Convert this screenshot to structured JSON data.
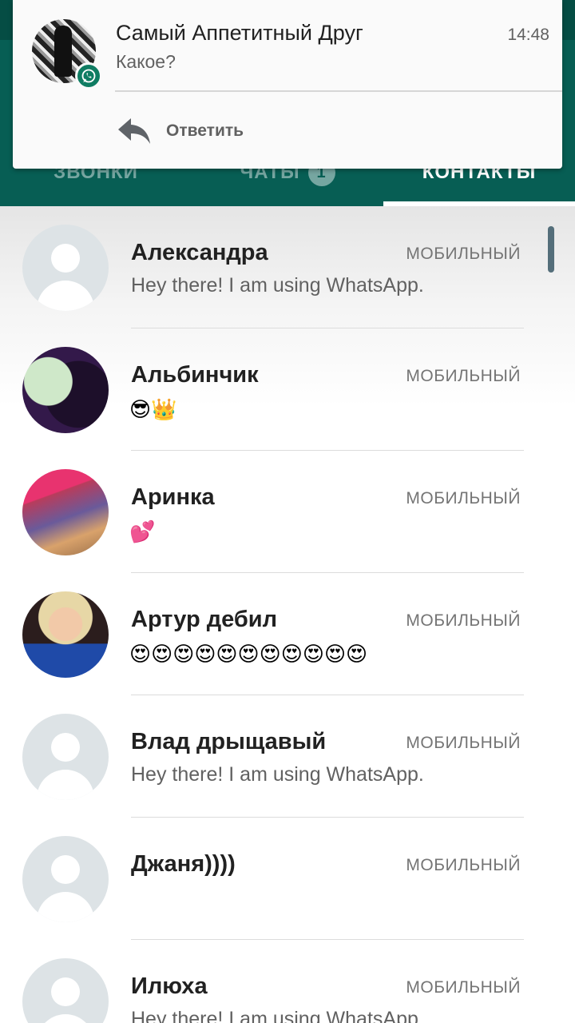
{
  "tabs": [
    {
      "label": "ЗВОНКИ"
    },
    {
      "label": "ЧАТЫ",
      "badge": "1"
    },
    {
      "label": "КОНТАКТЫ"
    }
  ],
  "notification": {
    "title": "Самый Аппетитный Друг",
    "time": "14:48",
    "text": "Какое?",
    "reply_label": "Ответить",
    "app_icon": "whatsapp-icon"
  },
  "contacts": [
    {
      "name": "Александра",
      "type": "МОБИЛЬНЫЙ",
      "status": "Hey there! I am using WhatsApp.",
      "avatar": "default"
    },
    {
      "name": "Альбинчик",
      "type": "МОБИЛЬНЫЙ",
      "status": "😎👑",
      "avatar": "photo"
    },
    {
      "name": "Аринка",
      "type": "МОБИЛЬНЫЙ",
      "status": "💕",
      "avatar": "photo"
    },
    {
      "name": "Артур дебил",
      "type": "МОБИЛЬНЫЙ",
      "status": "😍😍😍😍😍😍😍😍😍😍😍",
      "avatar": "photo"
    },
    {
      "name": "Влад дрыщавый",
      "type": "МОБИЛЬНЫЙ",
      "status": "Hey there! I am using WhatsApp.",
      "avatar": "default"
    },
    {
      "name": "Джаня))))",
      "type": "МОБИЛЬНЫЙ",
      "status": "",
      "avatar": "default"
    },
    {
      "name": "Илюха",
      "type": "МОБИЛЬНЫЙ",
      "status": "Hey there! I am using WhatsApp.",
      "avatar": "default"
    }
  ],
  "colors": {
    "header": "#075e54",
    "badge": "#0f7c62",
    "reply_icon": "#5f6368"
  }
}
